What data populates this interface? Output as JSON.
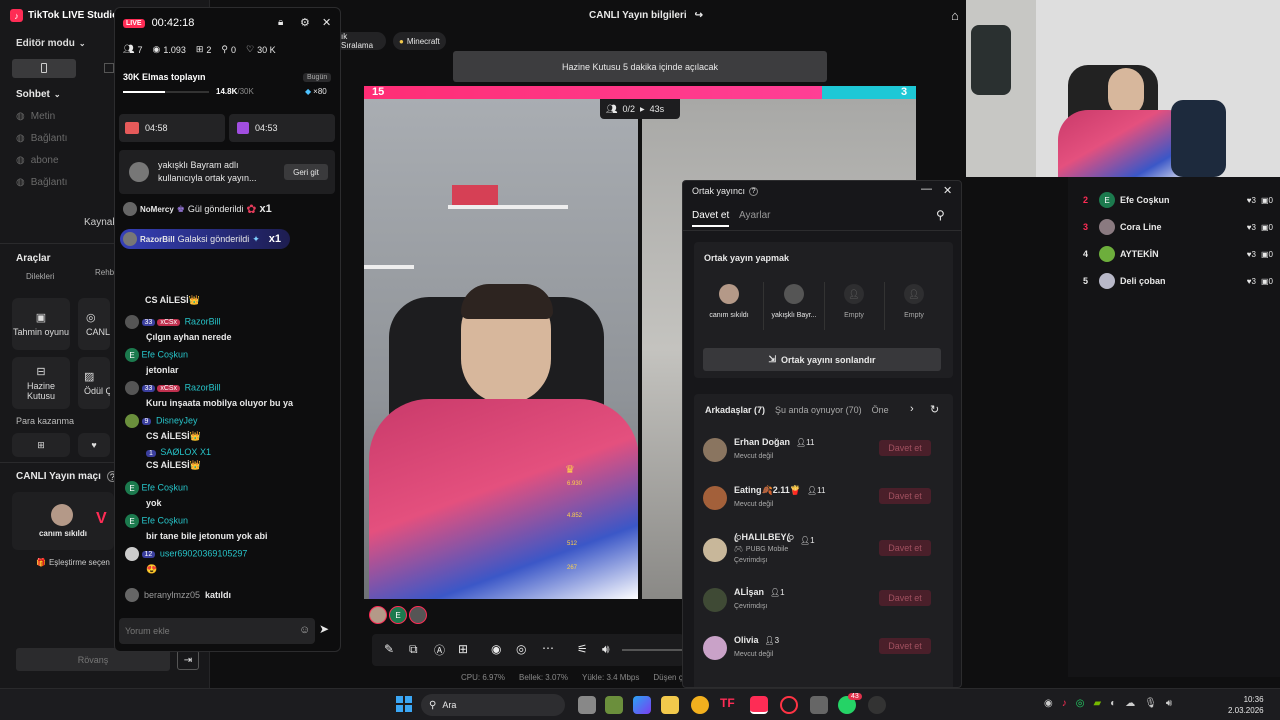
{
  "app": {
    "title": "TikTok LIVE Studio"
  },
  "sidebar": {
    "mode_label": "Editör modu",
    "chat_label": "Sohbet",
    "items": [
      "Metin",
      "Bağlantı",
      "abone",
      "Bağlantı"
    ],
    "sources_label": "Kaynak",
    "tools_label": "Araçlar",
    "tools_top": [
      "Dilekleri",
      "Rehb"
    ],
    "tools": [
      "Tahmin oyunu",
      "CANLI Hede",
      "Hazine Kutusu",
      "Ödül Ç"
    ],
    "earn_label": "Para kazanma",
    "match_label": "CANLI Yayın maçı",
    "match_user": "canım sıkıldı",
    "pairing_label": "Eşleştirme seçen",
    "rematch_label": "Rövanş"
  },
  "chat": {
    "live_badge": "LIVE",
    "timer": "00:42:18",
    "stats": {
      "viewers": "7",
      "views": "1.093",
      "gifts": "2",
      "shares": "0",
      "likes": "30 K"
    },
    "goal_title": "30K Elmas toplayın",
    "goal_period": "Bugün",
    "goal_progress": "14.8K",
    "goal_total": "/30K",
    "goal_fraction": 0.49,
    "goal_multiplier": "×80",
    "timer_a": "04:58",
    "timer_b": "04:53",
    "notice": "yakışklı Bayram adlı kullanıcıyla ortak yayın...",
    "notice_button": "Geri git",
    "gifts": [
      {
        "user": "NoMercy",
        "text": "Gül gönderildi",
        "count": "x1"
      },
      {
        "user": "RazorBill",
        "text": "Galaksi gönderildi",
        "count": "x1"
      }
    ],
    "messages": [
      {
        "user": "",
        "text": "CS AİLESİ👑"
      },
      {
        "user": "RazorBill",
        "badge": "33",
        "badge2": "xCSx",
        "text": "Çılgın ayhan nerede"
      },
      {
        "user": "Efe Coşkun",
        "text": "jetonlar"
      },
      {
        "user": "RazorBill",
        "badge": "33",
        "badge2": "xCSx",
        "text": "Kuru inşaata mobilya oluyor bu ya"
      },
      {
        "user": "DisneyJey",
        "badge": "9",
        "text": "CS AİLESİ👑"
      },
      {
        "user": "SAØLOX X1",
        "badge": "1",
        "text": "CS AİLESİ👑"
      },
      {
        "user": "Efe Coşkun",
        "text": "yok"
      },
      {
        "user": "Efe Coşkun",
        "text": "bir tane bile jetonum yok abi"
      },
      {
        "user": "user69020369105297",
        "badge": "12",
        "text": "😍"
      }
    ],
    "joined": {
      "user": "beranylmzz05",
      "text": "katıldı"
    },
    "input_placeholder": "Yorum ekle"
  },
  "stage": {
    "title": "CANLI Yayın bilgileri",
    "tags": [
      "ık Sıralama",
      "Minecraft"
    ],
    "banner": "Hazine Kutusu 5 dakika içinde açılacak",
    "battle_left": "15",
    "battle_right": "3",
    "battle_fraction": 0.83,
    "guests": "0/2",
    "countdown": "43s",
    "overlay_values": [
      "6.930",
      "4.852",
      "512",
      "267"
    ],
    "status": [
      {
        "label": "CPU:",
        "value": "6.97%"
      },
      {
        "label": "Bellek:",
        "value": "3.07%"
      },
      {
        "label": "Yükle:",
        "value": "3.4 Mbps"
      },
      {
        "label": "Düşen çer",
        "value": ""
      }
    ]
  },
  "cohost": {
    "title": "Ortak yayıncı",
    "tab_invite": "Davet et",
    "tab_settings": "Ayarlar",
    "section_title": "Ortak yayın yapmak",
    "slots": [
      "canım sıkıldı",
      "yakışklı Bayr...",
      "Empty",
      "Empty"
    ],
    "end_button": "Ortak yayını sonlandır",
    "filters": [
      "Arkadaşlar (7)",
      "Şu anda oynuyor (70)",
      "Öne"
    ],
    "friends": [
      {
        "name": "Erhan Doğan",
        "count": "11",
        "status": "Mevcut değil",
        "sub": ""
      },
      {
        "name": "Eating🍂2.11🍟",
        "count": "11",
        "status": "Mevcut değil",
        "sub": ""
      },
      {
        "name": "ꦿHALILBEYꦿ",
        "count": "1",
        "status": "Çevrimdışı",
        "sub": "PUBG Mobile"
      },
      {
        "name": "ALİşan",
        "count": "1",
        "status": "Çevrimdışı",
        "sub": ""
      },
      {
        "name": "Olivia",
        "count": "3",
        "status": "Mevcut değil",
        "sub": ""
      }
    ],
    "invite_label": "Davet et"
  },
  "ranking": [
    {
      "rank": "2",
      "name": "Efe Coşkun",
      "a": "3",
      "b": "0"
    },
    {
      "rank": "3",
      "name": "Cora Line",
      "a": "3",
      "b": "0"
    },
    {
      "rank": "4",
      "name": "AYTEKİN",
      "a": "3",
      "b": "0"
    },
    {
      "rank": "5",
      "name": "Deli çoban",
      "a": "3",
      "b": "0"
    }
  ],
  "taskbar": {
    "search": "Ara",
    "time": "10:36",
    "date": "2.03.2026",
    "badge": "43"
  }
}
